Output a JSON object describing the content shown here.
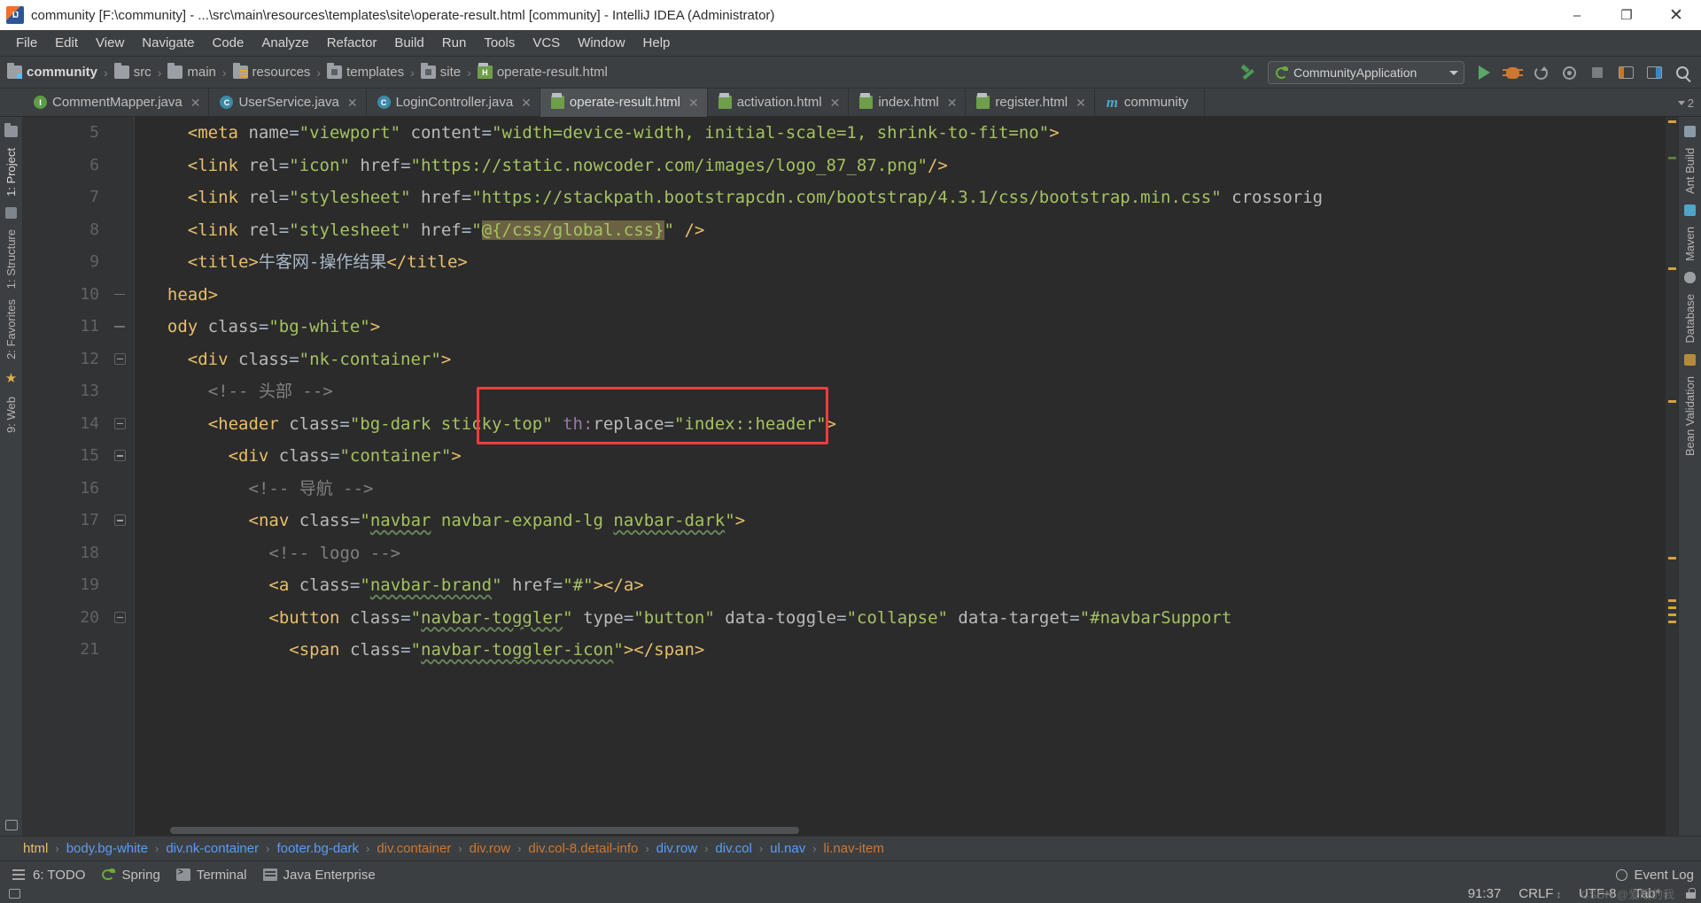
{
  "window": {
    "title": "community [F:\\community] - ...\\src\\main\\resources\\templates\\site\\operate-result.html [community] - IntelliJ IDEA (Administrator)",
    "app_icon": "intellij-idea-icon",
    "minimize": "–",
    "maximize": "❐",
    "close": "✕"
  },
  "menu": {
    "items": [
      {
        "label": "File"
      },
      {
        "label": "Edit"
      },
      {
        "label": "View"
      },
      {
        "label": "Navigate"
      },
      {
        "label": "Code"
      },
      {
        "label": "Analyze"
      },
      {
        "label": "Refactor"
      },
      {
        "label": "Build"
      },
      {
        "label": "Run"
      },
      {
        "label": "Tools"
      },
      {
        "label": "VCS"
      },
      {
        "label": "Window"
      },
      {
        "label": "Help"
      }
    ]
  },
  "breadcrumb": {
    "separator": "›",
    "items": [
      {
        "label": "community",
        "icon": "module-icon"
      },
      {
        "label": "src",
        "icon": "folder-icon"
      },
      {
        "label": "main",
        "icon": "folder-icon"
      },
      {
        "label": "resources",
        "icon": "resources-folder-icon"
      },
      {
        "label": "templates",
        "icon": "folder-icon"
      },
      {
        "label": "site",
        "icon": "folder-icon"
      },
      {
        "label": "operate-result.html",
        "icon": "html-file-icon"
      }
    ]
  },
  "toolbar": {
    "build_icon": "hammer-icon",
    "run_config": "CommunityApplication",
    "run_config_icon": "spring-boot-icon",
    "dropdown_icon": "chevron-down-icon",
    "run_icon": "run-play-icon",
    "debug_icon": "debug-bug-icon",
    "rerun_icon": "rerun-icon",
    "coverage_icon": "run-coverage-icon",
    "stop_icon": "stop-icon",
    "layout_left_icon": "layout-left-icon",
    "layout_right_icon": "layout-right-icon",
    "search_icon": "search-everywhere-icon"
  },
  "tabs": {
    "overflow_count": "2",
    "items": [
      {
        "label": "CommentMapper.java",
        "icon": "java-interface-icon",
        "active": false,
        "close": "✕"
      },
      {
        "label": "UserService.java",
        "icon": "java-class-icon",
        "active": false,
        "close": "✕"
      },
      {
        "label": "LoginController.java",
        "icon": "java-class-icon",
        "active": false,
        "close": "✕"
      },
      {
        "label": "operate-result.html",
        "icon": "html-file-icon",
        "active": true,
        "close": "✕"
      },
      {
        "label": "activation.html",
        "icon": "html-file-icon",
        "active": false,
        "close": "✕"
      },
      {
        "label": "index.html",
        "icon": "html-file-icon",
        "active": false,
        "close": "✕"
      },
      {
        "label": "register.html",
        "icon": "html-file-icon",
        "active": false,
        "close": "✕"
      },
      {
        "label": "community",
        "icon": "maven-module-icon",
        "active": false,
        "close": ""
      }
    ]
  },
  "left_tool_window": {
    "items": [
      {
        "label": "1: Project",
        "icon": "project-icon"
      },
      {
        "label": "1: Structure",
        "icon": "structure-icon"
      },
      {
        "label": "2: Favorites",
        "icon": "favorites-star-icon"
      },
      {
        "label": "9: Web",
        "icon": "web-icon"
      }
    ]
  },
  "right_tool_window": {
    "items": [
      {
        "label": "Ant Build",
        "icon": "ant-icon"
      },
      {
        "label": "Maven",
        "icon": "maven-icon"
      },
      {
        "label": "Database",
        "icon": "database-icon"
      },
      {
        "label": "Bean Validation",
        "icon": "bean-validation-icon"
      }
    ]
  },
  "editor": {
    "first_line": 5,
    "lines": [
      {
        "num": "5",
        "fold": "none",
        "indent": 2,
        "tokens": [
          {
            "t": "<meta",
            "c": "tg"
          },
          {
            "t": " ",
            "c": "tx"
          },
          {
            "t": "name",
            "c": "at"
          },
          {
            "t": "=",
            "c": "eq"
          },
          {
            "t": "\"viewport\"",
            "c": "st"
          },
          {
            "t": " ",
            "c": "tx"
          },
          {
            "t": "content",
            "c": "at"
          },
          {
            "t": "=",
            "c": "eq"
          },
          {
            "t": "\"width=device-width, initial-scale=1, shrink-to-fit=no\"",
            "c": "st"
          },
          {
            "t": ">",
            "c": "tg"
          }
        ]
      },
      {
        "num": "6",
        "fold": "none",
        "indent": 2,
        "tokens": [
          {
            "t": "<link",
            "c": "tg"
          },
          {
            "t": " ",
            "c": "tx"
          },
          {
            "t": "rel",
            "c": "at"
          },
          {
            "t": "=",
            "c": "eq"
          },
          {
            "t": "\"icon\"",
            "c": "st"
          },
          {
            "t": " ",
            "c": "tx"
          },
          {
            "t": "href",
            "c": "at"
          },
          {
            "t": "=",
            "c": "eq"
          },
          {
            "t": "\"https://static.nowcoder.com/images/logo_87_87.png\"",
            "c": "st"
          },
          {
            "t": "/>",
            "c": "tg"
          }
        ]
      },
      {
        "num": "7",
        "fold": "none",
        "indent": 2,
        "tokens": [
          {
            "t": "<link",
            "c": "tg"
          },
          {
            "t": " ",
            "c": "tx"
          },
          {
            "t": "rel",
            "c": "at"
          },
          {
            "t": "=",
            "c": "eq"
          },
          {
            "t": "\"stylesheet\"",
            "c": "st"
          },
          {
            "t": " ",
            "c": "tx"
          },
          {
            "t": "href",
            "c": "at"
          },
          {
            "t": "=",
            "c": "eq"
          },
          {
            "t": "\"https://stackpath.bootstrapcdn.com/bootstrap/4.3.1/css/bootstrap.min.css\"",
            "c": "st"
          },
          {
            "t": " ",
            "c": "tx"
          },
          {
            "t": "crossorig",
            "c": "at"
          }
        ]
      },
      {
        "num": "8",
        "fold": "none",
        "indent": 2,
        "tokens": [
          {
            "t": "<link",
            "c": "tg"
          },
          {
            "t": " ",
            "c": "tx"
          },
          {
            "t": "rel",
            "c": "at"
          },
          {
            "t": "=",
            "c": "eq"
          },
          {
            "t": "\"stylesheet\"",
            "c": "st"
          },
          {
            "t": " ",
            "c": "tx"
          },
          {
            "t": "href",
            "c": "at"
          },
          {
            "t": "=",
            "c": "eq"
          },
          {
            "t": "\"",
            "c": "st"
          },
          {
            "t": "@{/css/global.css}",
            "c": "st hl"
          },
          {
            "t": "\"",
            "c": "st"
          },
          {
            "t": " />",
            "c": "tg"
          }
        ]
      },
      {
        "num": "9",
        "fold": "none",
        "indent": 2,
        "tokens": [
          {
            "t": "<title>",
            "c": "tg"
          },
          {
            "t": "牛客网-操作结果",
            "c": "tx"
          },
          {
            "t": "</title>",
            "c": "tg"
          }
        ]
      },
      {
        "num": "10",
        "fold": "plain",
        "indent": 1,
        "tokens": [
          {
            "t": "head>",
            "c": "tg"
          }
        ]
      },
      {
        "num": "11",
        "fold": "plain",
        "indent": 1,
        "tokens": [
          {
            "t": "ody ",
            "c": "tg"
          },
          {
            "t": "class",
            "c": "at"
          },
          {
            "t": "=",
            "c": "eq"
          },
          {
            "t": "\"bg-white\"",
            "c": "st"
          },
          {
            "t": ">",
            "c": "tg"
          }
        ]
      },
      {
        "num": "12",
        "fold": "box",
        "indent": 2,
        "tokens": [
          {
            "t": "<div ",
            "c": "tg"
          },
          {
            "t": "class",
            "c": "at"
          },
          {
            "t": "=",
            "c": "eq"
          },
          {
            "t": "\"nk-container\"",
            "c": "st"
          },
          {
            "t": ">",
            "c": "tg"
          }
        ]
      },
      {
        "num": "13",
        "fold": "none",
        "indent": 3,
        "tokens": [
          {
            "t": "<!-- 头部 -->",
            "c": "cm"
          }
        ]
      },
      {
        "num": "14",
        "fold": "box",
        "indent": 3,
        "tokens": [
          {
            "t": "<header ",
            "c": "tg"
          },
          {
            "t": "class",
            "c": "at"
          },
          {
            "t": "=",
            "c": "eq"
          },
          {
            "t": "\"bg-dark sticky-top\"",
            "c": "st"
          },
          {
            "t": " ",
            "c": "tx"
          },
          {
            "t": "th:",
            "c": "th"
          },
          {
            "t": "replace",
            "c": "at"
          },
          {
            "t": "=",
            "c": "eq"
          },
          {
            "t": "\"index::header\"",
            "c": "st"
          },
          {
            "t": ">",
            "c": "tg"
          }
        ]
      },
      {
        "num": "15",
        "fold": "box",
        "indent": 4,
        "tokens": [
          {
            "t": "<div ",
            "c": "tg"
          },
          {
            "t": "class",
            "c": "at"
          },
          {
            "t": "=",
            "c": "eq"
          },
          {
            "t": "\"container\"",
            "c": "st"
          },
          {
            "t": ">",
            "c": "tg"
          }
        ]
      },
      {
        "num": "16",
        "fold": "none",
        "indent": 5,
        "tokens": [
          {
            "t": "<!-- 导航 -->",
            "c": "cm"
          }
        ]
      },
      {
        "num": "17",
        "fold": "box",
        "indent": 5,
        "tokens": [
          {
            "t": "<nav ",
            "c": "tg"
          },
          {
            "t": "class",
            "c": "at"
          },
          {
            "t": "=",
            "c": "eq"
          },
          {
            "t": "\"",
            "c": "st"
          },
          {
            "t": "navbar",
            "c": "st wavy"
          },
          {
            "t": " ",
            "c": "st"
          },
          {
            "t": "navbar-expand-lg",
            "c": "st"
          },
          {
            "t": " ",
            "c": "st"
          },
          {
            "t": "navbar-dark",
            "c": "st wavy"
          },
          {
            "t": "\"",
            "c": "st"
          },
          {
            "t": ">",
            "c": "tg"
          }
        ]
      },
      {
        "num": "18",
        "fold": "none",
        "indent": 6,
        "tokens": [
          {
            "t": "<!-- logo -->",
            "c": "cm"
          }
        ]
      },
      {
        "num": "19",
        "fold": "none",
        "indent": 6,
        "tokens": [
          {
            "t": "<a ",
            "c": "tg"
          },
          {
            "t": "class",
            "c": "at"
          },
          {
            "t": "=",
            "c": "eq"
          },
          {
            "t": "\"",
            "c": "st"
          },
          {
            "t": "navbar-brand",
            "c": "st wavy"
          },
          {
            "t": "\"",
            "c": "st"
          },
          {
            "t": " ",
            "c": "tx"
          },
          {
            "t": "href",
            "c": "at"
          },
          {
            "t": "=",
            "c": "eq"
          },
          {
            "t": "\"#\"",
            "c": "st"
          },
          {
            "t": "></a>",
            "c": "tg"
          }
        ]
      },
      {
        "num": "20",
        "fold": "box",
        "indent": 6,
        "tokens": [
          {
            "t": "<button ",
            "c": "tg"
          },
          {
            "t": "class",
            "c": "at"
          },
          {
            "t": "=",
            "c": "eq"
          },
          {
            "t": "\"",
            "c": "st"
          },
          {
            "t": "navbar-toggler",
            "c": "st wavy"
          },
          {
            "t": "\"",
            "c": "st"
          },
          {
            "t": " ",
            "c": "tx"
          },
          {
            "t": "type",
            "c": "at"
          },
          {
            "t": "=",
            "c": "eq"
          },
          {
            "t": "\"button\"",
            "c": "st"
          },
          {
            "t": " ",
            "c": "tx"
          },
          {
            "t": "data-toggle",
            "c": "at"
          },
          {
            "t": "=",
            "c": "eq"
          },
          {
            "t": "\"collapse\"",
            "c": "st"
          },
          {
            "t": " ",
            "c": "tx"
          },
          {
            "t": "data-target",
            "c": "at"
          },
          {
            "t": "=",
            "c": "eq"
          },
          {
            "t": "\"#navbarSupport",
            "c": "st"
          }
        ]
      },
      {
        "num": "21",
        "fold": "none",
        "indent": 7,
        "tokens": [
          {
            "t": "<span ",
            "c": "tg"
          },
          {
            "t": "class",
            "c": "at"
          },
          {
            "t": "=",
            "c": "eq"
          },
          {
            "t": "\"",
            "c": "st"
          },
          {
            "t": "navbar-toggler-icon",
            "c": "st wavy"
          },
          {
            "t": "\"",
            "c": "st"
          },
          {
            "t": "></span>",
            "c": "tg"
          }
        ]
      }
    ],
    "annotation_box": {
      "color": "#ff3b3b",
      "target": "th:replace=\"index::header\""
    }
  },
  "element_path": {
    "separator": "›",
    "items": [
      {
        "label": "html",
        "color": "#e8bf6a"
      },
      {
        "label": "body.bg-white",
        "color": "#589df6"
      },
      {
        "label": "div.nk-container",
        "color": "#589df6"
      },
      {
        "label": "footer.bg-dark",
        "color": "#589df6"
      },
      {
        "label": "div.container",
        "color": "#cc7832"
      },
      {
        "label": "div.row",
        "color": "#cc7832"
      },
      {
        "label": "div.col-8.detail-info",
        "color": "#cc7832"
      },
      {
        "label": "div.row",
        "color": "#589df6"
      },
      {
        "label": "div.col",
        "color": "#589df6"
      },
      {
        "label": "ul.nav",
        "color": "#589df6"
      },
      {
        "label": "li.nav-item",
        "color": "#cc7832"
      }
    ]
  },
  "status_bar": {
    "buttons": [
      {
        "label": "6: TODO",
        "icon": "todo-icon"
      },
      {
        "label": "Spring",
        "icon": "spring-icon"
      },
      {
        "label": "Terminal",
        "icon": "terminal-icon"
      },
      {
        "label": "Java Enterprise",
        "icon": "java-enterprise-icon"
      }
    ],
    "event_log": {
      "label": "Event Log",
      "icon": "event-log-icon"
    },
    "caret_position": "91:37",
    "line_separator": "CRLF",
    "encoding": "UTF-8",
    "indent": "Tab*",
    "lock_icon": "lock-icon",
    "watermark": "CSDN @爱眠的我"
  }
}
